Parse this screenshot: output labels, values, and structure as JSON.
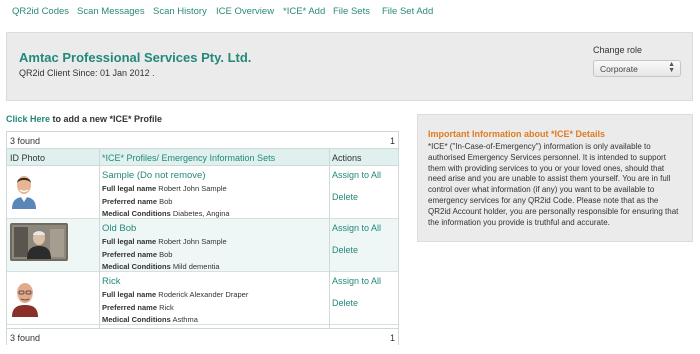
{
  "nav": {
    "items": [
      "QR2id Codes",
      "Scan Messages",
      "Scan History",
      "ICE Overview",
      "*ICE* Add",
      "File Sets",
      "File Set Add"
    ]
  },
  "header": {
    "company": "Amtac Professional Services Pty. Ltd.",
    "client_since": "QR2id Client Since: 01 Jan 2012 .",
    "change_role_label": "Change role",
    "role_value": "Corporate"
  },
  "add_profile": {
    "link": "Click Here",
    "text": " to add a new *ICE* Profile"
  },
  "table": {
    "count_label": "3 found",
    "page": "1",
    "columns": [
      "ID Photo",
      "*ICE* Profiles/ Emergency Information Sets",
      "Actions"
    ],
    "field_labels": {
      "legal": "Full legal name",
      "preferred": "Preferred name",
      "medical": "Medical Conditions"
    },
    "rows": [
      {
        "name": "Sample (Do not remove)",
        "legal_name": "Robert John Sample",
        "preferred_name": "Bob",
        "medical": "Diabetes, Angina",
        "action1": "Assign to All",
        "action2": "Delete",
        "photo_icon": "man-smiling-photo"
      },
      {
        "name": "Old Bob",
        "legal_name": "Robert John Sample",
        "preferred_name": "Bob",
        "medical": "Mild dementia",
        "action1": "Assign to All",
        "action2": "Delete",
        "photo_icon": "elderly-man-photo"
      },
      {
        "name": "Rick",
        "legal_name": "Roderick Alexander Draper",
        "preferred_name": "Rick",
        "medical": "Asthma",
        "action1": "Assign to All",
        "action2": "Delete",
        "photo_icon": "bald-man-photo"
      }
    ]
  },
  "info": {
    "title": "Important Information about *ICE* Details",
    "body": "*ICE* (\"In-Case-of-Emergency\") information is only available to authorised Emergency Services personnel. It is intended to support them with providing services to you or your loved ones, should that need arise and you are unable to assist them yourself. You are in full control over what information (if any) you want to be available to emergency services for any QR2id Code. Please note that as the QR2id Account holder, you are personally responsible for ensuring that the information you provide is truthful and accurate."
  },
  "colors": {
    "accent": "#22897a",
    "header_row": "#dff0ee",
    "info_title": "#e07b1f"
  }
}
